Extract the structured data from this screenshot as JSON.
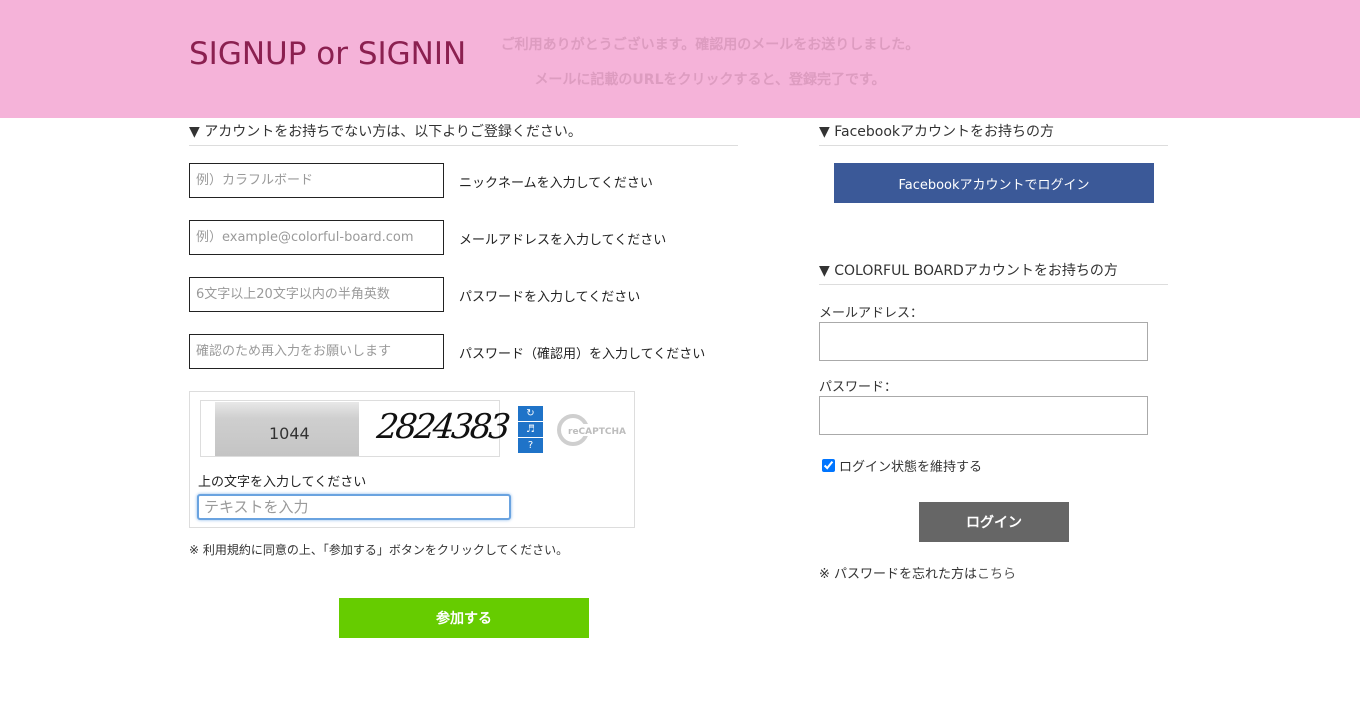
{
  "header": {
    "title": "SIGNUP or SIGNIN",
    "notice_line1": "ご利用ありがとうございます。確認用のメールをお送りしました。",
    "notice_line2": "メールに記載のURLをクリックすると、登録完了です。"
  },
  "signup": {
    "heading": "▼ アカウントをお持ちでない方は、以下よりご登録ください。",
    "fields": [
      {
        "placeholder": "例）カラフルボード",
        "hint": "ニックネームを入力してください"
      },
      {
        "placeholder": "例）example@colorful-board.com",
        "hint": "メールアドレスを入力してください"
      },
      {
        "placeholder": "6文字以上20文字以内の半角英数",
        "hint": "パスワードを入力してください"
      },
      {
        "placeholder": "確認のため再入力をお願いします",
        "hint": "パスワード（確認用）を入力してください"
      }
    ],
    "captcha": {
      "photo_text": "1044",
      "word_text": "2824383",
      "logo_text": "reCAPTCHA",
      "label": "上の文字を入力してください",
      "placeholder": "テキストを入力"
    },
    "terms": "※ 利用規約に同意の上、「参加する」ボタンをクリックしてください。",
    "submit_label": "参加する"
  },
  "facebook": {
    "heading": "▼ Facebookアカウントをお持ちの方",
    "button_label": "Facebookアカウントでログイン"
  },
  "login": {
    "heading": "▼ COLORFUL BOARDアカウントをお持ちの方",
    "email_label": "メールアドレス：",
    "password_label": "パスワード：",
    "remember_label": "ログイン状態を維持する",
    "remember_checked": true,
    "button_label": "ログイン",
    "forgot_prefix": "※ パスワードを忘れた方は",
    "forgot_link": "こちら"
  },
  "colors": {
    "header_bg": "#f5b3d9",
    "title_color": "#8b2050",
    "join_green": "#66cc00",
    "facebook_blue": "#3b5998",
    "login_gray": "#666666"
  }
}
